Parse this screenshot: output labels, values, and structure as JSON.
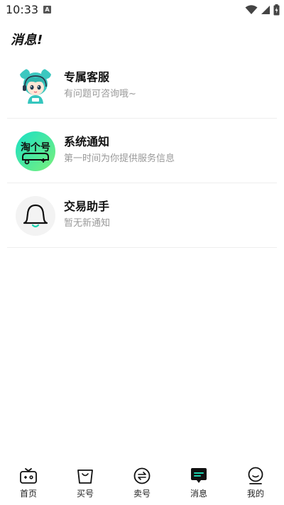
{
  "status_bar": {
    "time": "10:33",
    "notification_icon": "A"
  },
  "header": {
    "title": "消息!"
  },
  "messages": [
    {
      "title": "专属客服",
      "subtitle": "有问题可咨询哦~",
      "icon": "customer-service-avatar"
    },
    {
      "title": "系统通知",
      "subtitle": "第一时间为你提供服务信息",
      "icon": "system-notice-logo"
    },
    {
      "title": "交易助手",
      "subtitle": "暂无新通知",
      "icon": "bell-icon"
    }
  ],
  "system_logo_text": "淘个号",
  "bottom_nav": [
    {
      "label": "首页",
      "icon": "home-icon",
      "active": false
    },
    {
      "label": "买号",
      "icon": "buy-bag-icon",
      "active": false
    },
    {
      "label": "卖号",
      "icon": "sell-exchange-icon",
      "active": false
    },
    {
      "label": "消息",
      "icon": "message-icon",
      "active": true
    },
    {
      "label": "我的",
      "icon": "profile-icon",
      "active": false
    }
  ],
  "colors": {
    "accent": "#1dd3b0",
    "text_primary": "#111111",
    "text_secondary": "#999999",
    "divider": "#eeeeee"
  }
}
